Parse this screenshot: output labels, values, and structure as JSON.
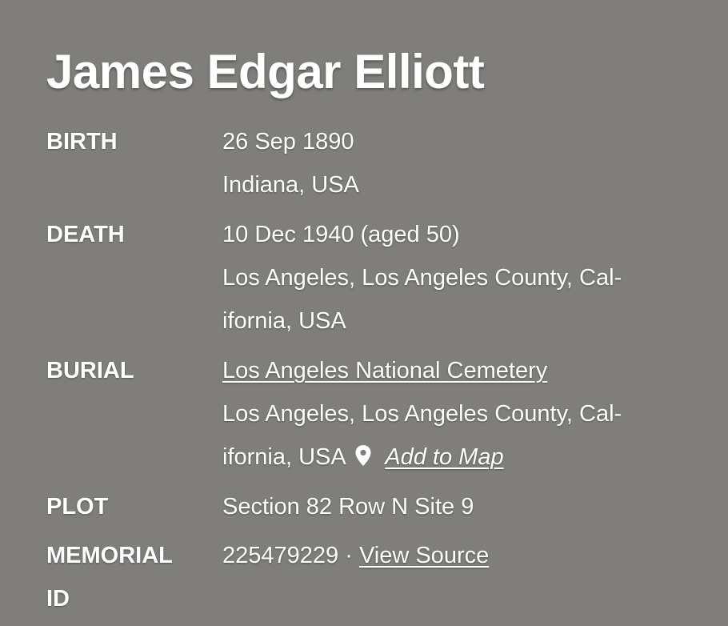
{
  "memorial": {
    "name": "James Edgar Elliott",
    "birth": {
      "label": "BIRTH",
      "date": "26 Sep 1890",
      "place": "Indiana, USA"
    },
    "death": {
      "label": "DEATH",
      "date": "10 Dec 1940 (aged 50)",
      "place_line1": "Los Angeles, Los Angeles County, Cal-",
      "place_line2": "ifornia, USA"
    },
    "burial": {
      "label": "BURIAL",
      "cemetery_link": "Los Angeles National Cemetery",
      "place_line1": "Los Angeles, Los Angeles County, Cal-",
      "place_line2": "ifornia, USA",
      "pin_icon": "map-pin-icon",
      "add_to_map": "Add to Map"
    },
    "plot": {
      "label": "PLOT",
      "value": "Section 82 Row N Site 9"
    },
    "memorial_id": {
      "label_line1": "MEMORIAL",
      "label_line2": "ID",
      "id": "225479229",
      "separator": "·",
      "view_source": "View Source"
    }
  },
  "colors": {
    "background": "#7f7e7a",
    "text": "#ffffff"
  }
}
